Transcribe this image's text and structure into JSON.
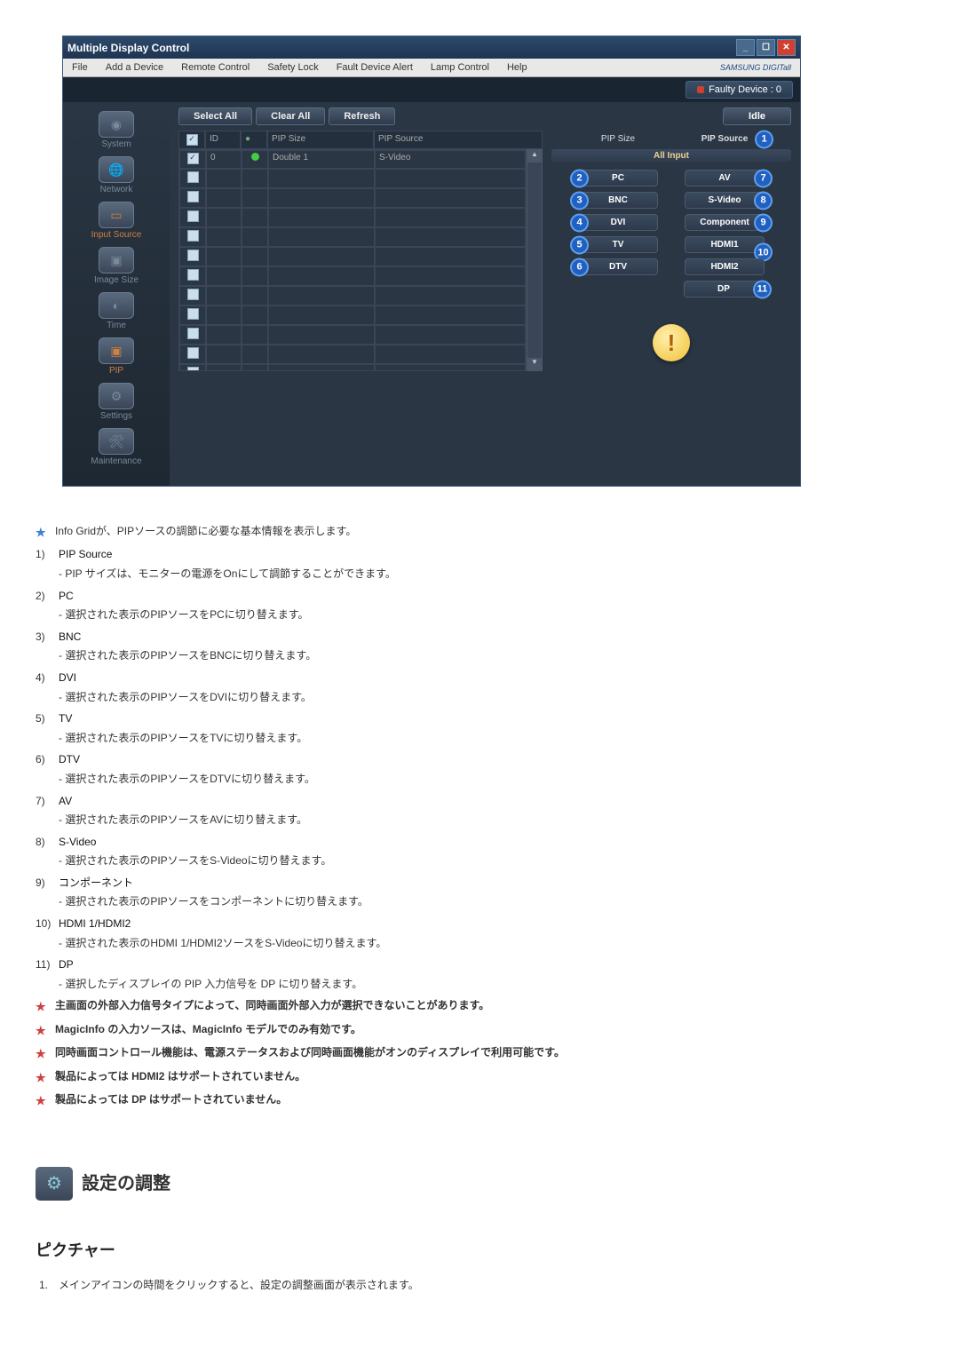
{
  "window": {
    "title": "Multiple Display Control",
    "menu": [
      "File",
      "Add a Device",
      "Remote Control",
      "Safety Lock",
      "Fault Device Alert",
      "Lamp Control",
      "Help"
    ],
    "brand": "SAMSUNG DIGITall",
    "fault": "Faulty Device : 0",
    "toolbar": {
      "select_all": "Select All",
      "clear_all": "Clear All",
      "refresh": "Refresh",
      "idle": "Idle"
    },
    "sidebar": [
      {
        "label": "System",
        "glyph": "◉"
      },
      {
        "label": "Network",
        "glyph": "🌐"
      },
      {
        "label": "Input Source",
        "glyph": "▭"
      },
      {
        "label": "Image Size",
        "glyph": "▣"
      },
      {
        "label": "Time",
        "glyph": "◐"
      },
      {
        "label": "PIP",
        "glyph": "▣"
      },
      {
        "label": "Settings",
        "glyph": "⚙"
      },
      {
        "label": "Maintenance",
        "glyph": "🛠"
      }
    ],
    "grid": {
      "headers": {
        "chk": "☑",
        "id": "ID",
        "dot": "●",
        "size": "PIP Size",
        "src": "PIP Source"
      },
      "rows": [
        {
          "checked": true,
          "id": "0",
          "dot": "green",
          "size": "Double 1",
          "src": "S-Video"
        },
        {},
        {},
        {},
        {},
        {},
        {},
        {},
        {},
        {},
        {},
        {}
      ]
    },
    "panel": {
      "label_size": "PIP Size",
      "label_source": "PIP Source",
      "badge_source": "1",
      "all_input": "All Input",
      "rows": [
        {
          "left": "PC",
          "lbadge": "2",
          "right": "AV",
          "rbadge": "7"
        },
        {
          "left": "BNC",
          "lbadge": "3",
          "right": "S-Video",
          "rbadge": "8"
        },
        {
          "left": "DVI",
          "lbadge": "4",
          "right": "Component",
          "rbadge": "9"
        },
        {
          "left": "TV",
          "lbadge": "5",
          "right": "HDMI1",
          "rbadge": "10"
        },
        {
          "left": "DTV",
          "lbadge": "6",
          "right": "HDMI2",
          "rbadge": ""
        },
        {
          "left": "",
          "lbadge": "",
          "right": "DP",
          "rbadge": "11"
        }
      ]
    }
  },
  "doc": {
    "info_line": "Info Gridが、PIPソースの調節に必要な基本情報を表示します。",
    "items": [
      {
        "n": "1)",
        "t": "PIP Source",
        "d": "- PIP サイズは、モニターの電源をOnにして調節することができます。"
      },
      {
        "n": "2)",
        "t": "PC",
        "d": "- 選択された表示のPIPソースをPCに切り替えます。"
      },
      {
        "n": "3)",
        "t": "BNC",
        "d": "- 選択された表示のPIPソースをBNCに切り替えます。"
      },
      {
        "n": "4)",
        "t": "DVI",
        "d": "- 選択された表示のPIPソースをDVIに切り替えます。"
      },
      {
        "n": "5)",
        "t": "TV",
        "d": "- 選択された表示のPIPソースをTVに切り替えます。"
      },
      {
        "n": "6)",
        "t": "DTV",
        "d": "- 選択された表示のPIPソースをDTVに切り替えます。"
      },
      {
        "n": "7)",
        "t": "AV",
        "d": "- 選択された表示のPIPソースをAVに切り替えます。"
      },
      {
        "n": "8)",
        "t": "S-Video",
        "d": "- 選択された表示のPIPソースをS-Videoに切り替えます。"
      },
      {
        "n": "9)",
        "t": "コンポーネント",
        "d": "- 選択された表示のPIPソースをコンポーネントに切り替えます。"
      },
      {
        "n": "10)",
        "t": "HDMI 1/HDMI2",
        "d": "- 選択された表示のHDMI 1/HDMI2ソースをS-Videoに切り替えます。"
      },
      {
        "n": "11)",
        "t": "DP",
        "d": "- 選択したディスプレイの PIP 入力信号を DP に切り替えます。"
      }
    ],
    "notes": [
      "主画面の外部入力信号タイプによって、同時画面外部入力が選択できないことがあります。",
      "MagicInfo の入力ソースは、MagicInfo モデルでのみ有効です。",
      "同時画面コントロール機能は、電源ステータスおよび同時画面機能がオンのディスプレイで利用可能です。",
      "製品によっては HDMI2 はサポートされていません。",
      "製品によっては DP はサポートされていません。"
    ],
    "section_title": "設定の調整",
    "subsection_title": "ピクチャー",
    "step1": {
      "n": "1.",
      "t": "メインアイコンの時間をクリックすると、設定の調整画面が表示されます。"
    }
  }
}
